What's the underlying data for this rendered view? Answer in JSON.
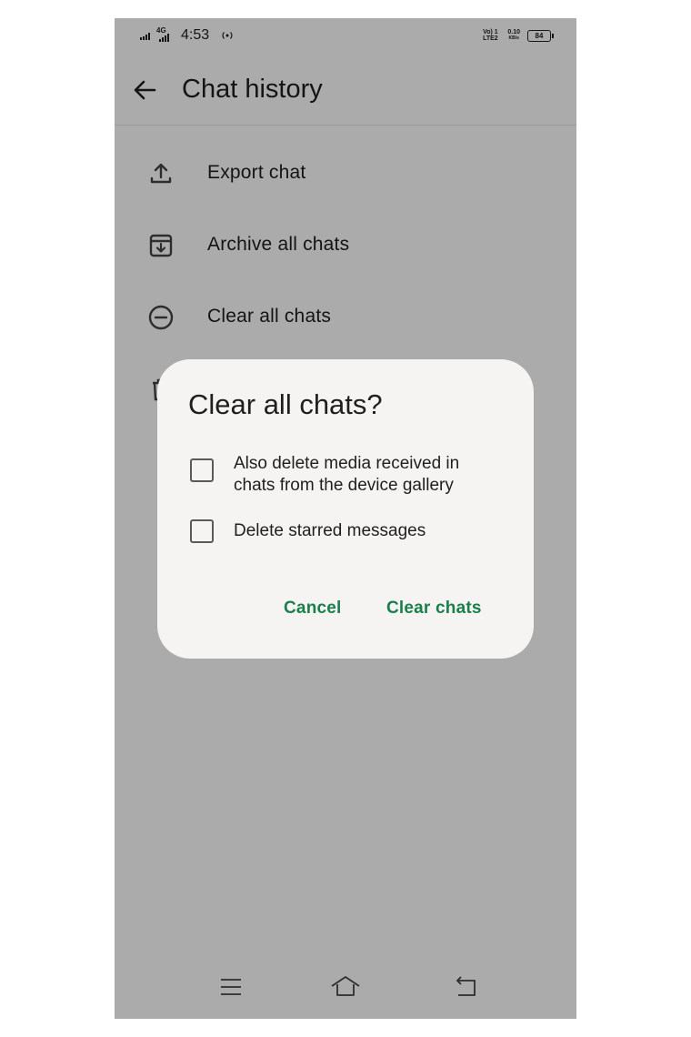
{
  "status_bar": {
    "time": "4:53",
    "network_label": "4G",
    "lte_label": "Vo) 1 LTE2",
    "speed_value": "0.10",
    "speed_unit": "KB/s",
    "battery_level": "84"
  },
  "app_bar": {
    "title": "Chat history",
    "back_icon": "arrow-left-icon"
  },
  "settings_list": [
    {
      "label": "Export chat",
      "icon": "upload-icon"
    },
    {
      "label": "Archive all chats",
      "icon": "archive-icon"
    },
    {
      "label": "Clear all chats",
      "icon": "minus-circle-icon"
    },
    {
      "label": "",
      "icon": "trash-icon"
    }
  ],
  "dialog": {
    "title": "Clear all chats?",
    "options": [
      {
        "line1": "Also delete media received in",
        "line2": "chats from the device gallery",
        "checked": false
      },
      {
        "line1": "Delete starred messages",
        "line2": "",
        "checked": false
      }
    ],
    "cancel_label": "Cancel",
    "confirm_label": "Clear chats"
  },
  "nav_bar": {
    "icons": [
      "menu-icon",
      "home-icon",
      "back-icon"
    ]
  },
  "colors": {
    "accent_green": "#1b7f4c",
    "dialog_bg": "#f5f4f2",
    "scrim": "rgba(0,0,0,0.33)"
  }
}
